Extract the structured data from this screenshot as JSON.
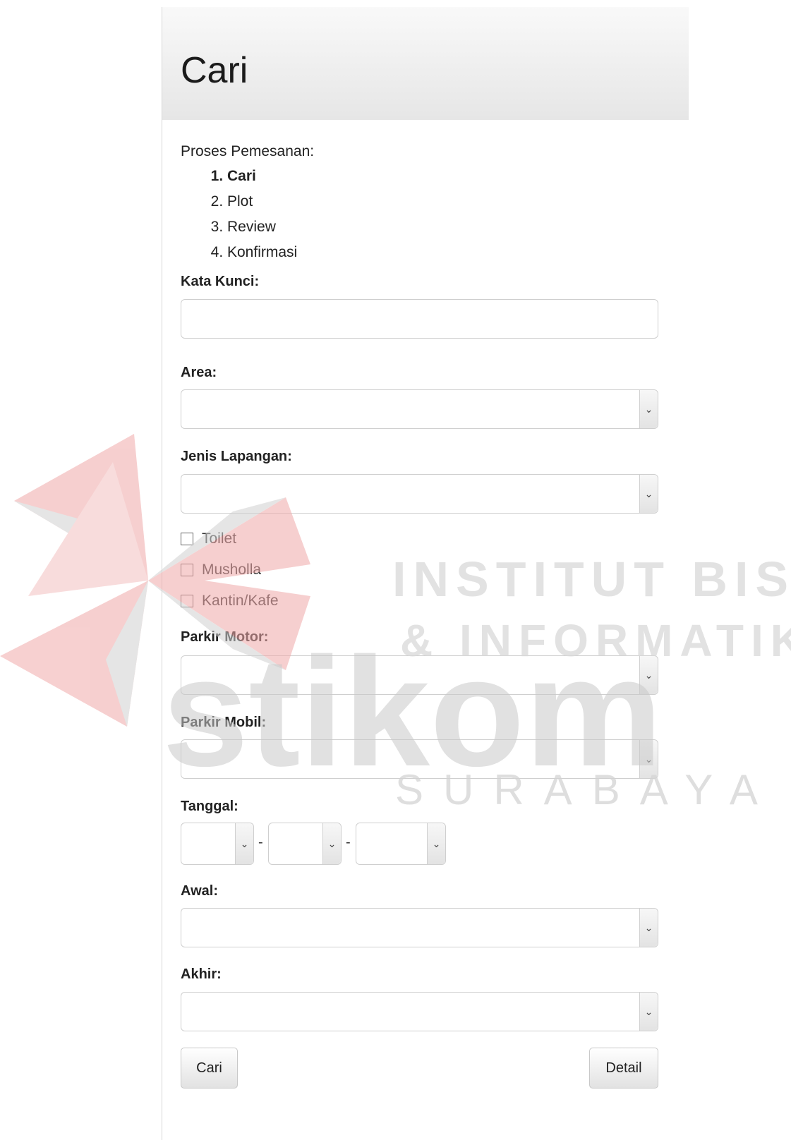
{
  "header": {
    "title": "Cari"
  },
  "intro": "Proses Pemesanan:",
  "steps": [
    "Cari",
    "Plot",
    "Review",
    "Konfirmasi"
  ],
  "fields": {
    "kata_kunci": {
      "label": "Kata Kunci:",
      "value": ""
    },
    "area": {
      "label": "Area:",
      "value": ""
    },
    "jenis_lapangan": {
      "label": "Jenis Lapangan:",
      "value": ""
    },
    "parkir_motor": {
      "label": "Parkir Motor:",
      "value": ""
    },
    "parkir_mobil": {
      "label": "Parkir Mobil:",
      "value": ""
    },
    "tanggal": {
      "label": "Tanggal:",
      "separator": "-"
    },
    "awal": {
      "label": "Awal:",
      "value": ""
    },
    "akhir": {
      "label": "Akhir:",
      "value": ""
    }
  },
  "facilities": [
    {
      "label": "Toilet",
      "checked": false
    },
    {
      "label": "Musholla",
      "checked": false
    },
    {
      "label": "Kantin/Kafe",
      "checked": false
    }
  ],
  "buttons": {
    "search": "Cari",
    "detail": "Detail"
  },
  "watermark": {
    "line1": "INSTITUT BISNIS",
    "line2": "& INFORMATIKA",
    "logo": "stikom",
    "city": "SURABAYA"
  },
  "colors": {
    "watermark_red": "#f1b4b4",
    "watermark_grey": "#dcdcdc",
    "header_bg": "#ebebeb"
  }
}
